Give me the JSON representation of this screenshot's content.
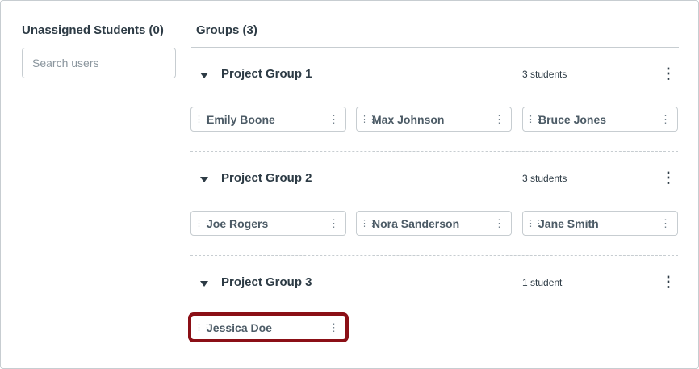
{
  "unassigned": {
    "title": "Unassigned Students (0)",
    "search_placeholder": "Search users"
  },
  "groups_title": "Groups (3)",
  "groups": [
    {
      "name": "Project Group 1",
      "count": "3 students",
      "students": [
        "Emily Boone",
        "Max Johnson",
        "Bruce Jones"
      ]
    },
    {
      "name": "Project Group 2",
      "count": "3 students",
      "students": [
        "Joe Rogers",
        "Nora Sanderson",
        "Jane Smith"
      ]
    },
    {
      "name": "Project Group 3",
      "count": "1 student",
      "students": [
        "Jessica Doe"
      ]
    }
  ],
  "highlight_color": "#8b0f16"
}
